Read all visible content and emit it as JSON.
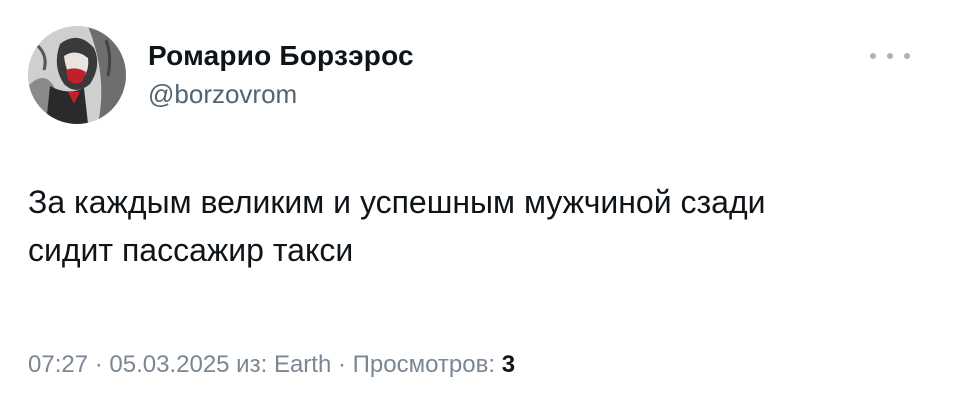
{
  "user": {
    "display_name": "Ромарио Борзэрос",
    "handle": "@borzovrom"
  },
  "tweet": {
    "text_lines": [
      "За каждым великим и успешным мужчиной сзади",
      "сидит пассажир такси"
    ]
  },
  "meta": {
    "time": "07:27",
    "separator_1": " · ",
    "date": "05.03.2025",
    "source_label": " из: ",
    "source": "Earth",
    "separator_2": " · ",
    "views_label": "Просмотров: ",
    "views_count": "3"
  },
  "icons": {
    "more": "more-horizontal-icon"
  }
}
